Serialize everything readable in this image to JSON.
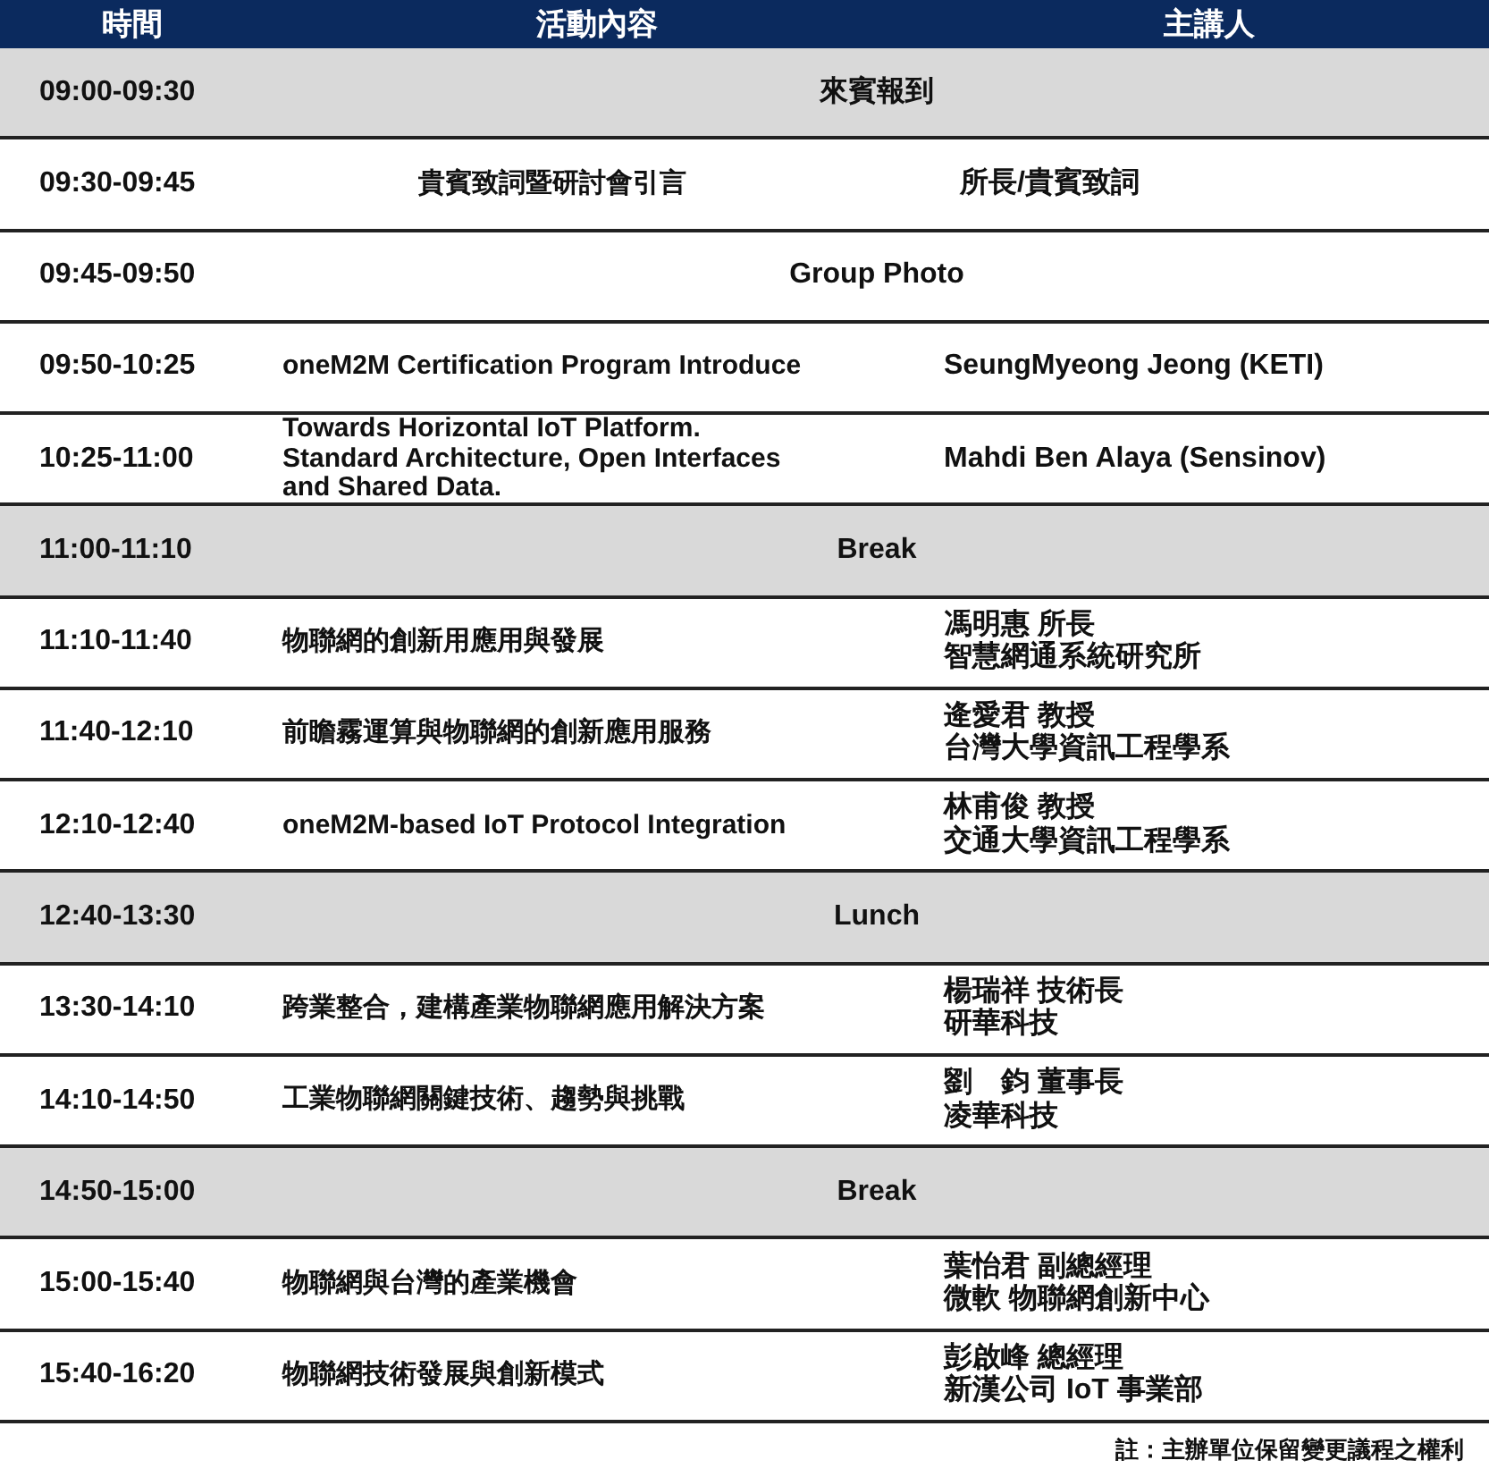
{
  "table": {
    "columns": [
      "時間",
      "活動內容",
      "主講人"
    ],
    "rows": [
      {
        "kind": "plenary",
        "time": "09:00-09:30",
        "title": "來賓報到",
        "shaded": true
      },
      {
        "kind": "session",
        "time": "09:30-09:45",
        "topic": "貴賓致詞暨研討會引言",
        "speaker": [
          "所長/貴賓致詞"
        ],
        "centered": true
      },
      {
        "kind": "plenary",
        "time": "09:45-09:50",
        "title": "Group Photo",
        "shaded": false
      },
      {
        "kind": "session",
        "time": "09:50-10:25",
        "topic": "oneM2M Certification Program Introduce",
        "speaker": [
          "SeungMyeong Jeong (KETI)"
        ],
        "centered": false
      },
      {
        "kind": "session",
        "time": "10:25-11:00",
        "topic": "Towards Horizontal IoT Platform. Standard Architecture, Open Interfaces and Shared Data.",
        "speaker": [
          "Mahdi Ben Alaya (Sensinov)"
        ],
        "centered": false
      },
      {
        "kind": "plenary",
        "time": "11:00-11:10",
        "title": "Break",
        "shaded": true
      },
      {
        "kind": "session",
        "time": "11:10-11:40",
        "topic": "物聯網的創新用應用與發展",
        "speaker": [
          "馮明惠 所長",
          "智慧網通系統研究所"
        ],
        "centered": false
      },
      {
        "kind": "session",
        "time": "11:40-12:10",
        "topic": "前瞻霧運算與物聯網的創新應用服務",
        "speaker": [
          "逄愛君 教授",
          "台灣大學資訊工程學系"
        ],
        "centered": false
      },
      {
        "kind": "session",
        "time": "12:10-12:40",
        "topic": "oneM2M-based IoT Protocol Integration",
        "speaker": [
          "林甫俊 教授",
          "交通大學資訊工程學系"
        ],
        "centered": false
      },
      {
        "kind": "plenary",
        "time": "12:40-13:30",
        "title": "Lunch",
        "shaded": true
      },
      {
        "kind": "session",
        "time": "13:30-14:10",
        "topic": "跨業整合，建構產業物聯網應用解決方案",
        "speaker": [
          "楊瑞祥 技術長",
          "研華科技"
        ],
        "centered": false
      },
      {
        "kind": "session",
        "time": "14:10-14:50",
        "topic": "工業物聯網關鍵技術、趨勢與挑戰",
        "speaker": [
          "劉　鈞 董事長",
          "凌華科技"
        ],
        "centered": false
      },
      {
        "kind": "plenary",
        "time": "14:50-15:00",
        "title": "Break",
        "shaded": true
      },
      {
        "kind": "session",
        "time": "15:00-15:40",
        "topic": "物聯網與台灣的產業機會",
        "speaker": [
          "葉怡君 副總經理",
          "微軟 物聯網創新中心"
        ],
        "centered": false
      },
      {
        "kind": "session",
        "time": "15:40-16:20",
        "topic": "物聯網技術發展與創新模式",
        "speaker": [
          "彭啟峰 總經理",
          "新漢公司 IoT 事業部"
        ],
        "centered": false
      }
    ]
  },
  "note": "註：主辦單位保留變更議程之權利"
}
